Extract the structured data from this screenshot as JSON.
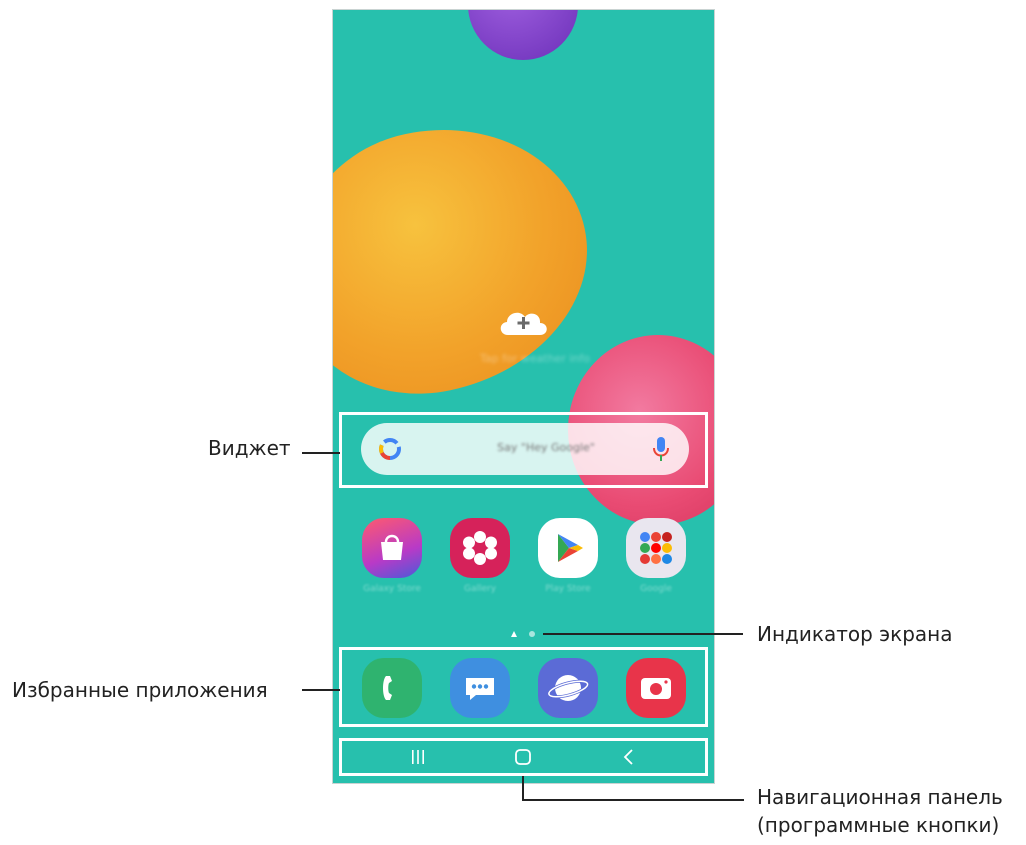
{
  "labels": {
    "widget": "Виджет",
    "favorites": "Избранные приложения",
    "screen_indicator": "Индикатор экрана",
    "nav_bar_line1": "Навигационная панель",
    "nav_bar_line2": "(программные кнопки)"
  },
  "home": {
    "search_hint": "Say \"Hey Google\"",
    "cloud_caption": "Tap for weather info",
    "apps": [
      {
        "label": "Galaxy Store",
        "icon": "galaxy-store-icon"
      },
      {
        "label": "Gallery",
        "icon": "gallery-icon"
      },
      {
        "label": "Play Store",
        "icon": "play-store-icon"
      },
      {
        "label": "Google",
        "icon": "google-folder-icon"
      }
    ],
    "dock": [
      {
        "icon": "phone-icon",
        "color": "#2fb36f"
      },
      {
        "icon": "messages-icon",
        "color": "#3f8fe0"
      },
      {
        "icon": "internet-icon",
        "color": "#5b6bd6"
      },
      {
        "icon": "camera-icon",
        "color": "#e8344a"
      }
    ]
  },
  "colors": {
    "wallpaper": "#27c0ad",
    "callout_line": "#222222"
  }
}
